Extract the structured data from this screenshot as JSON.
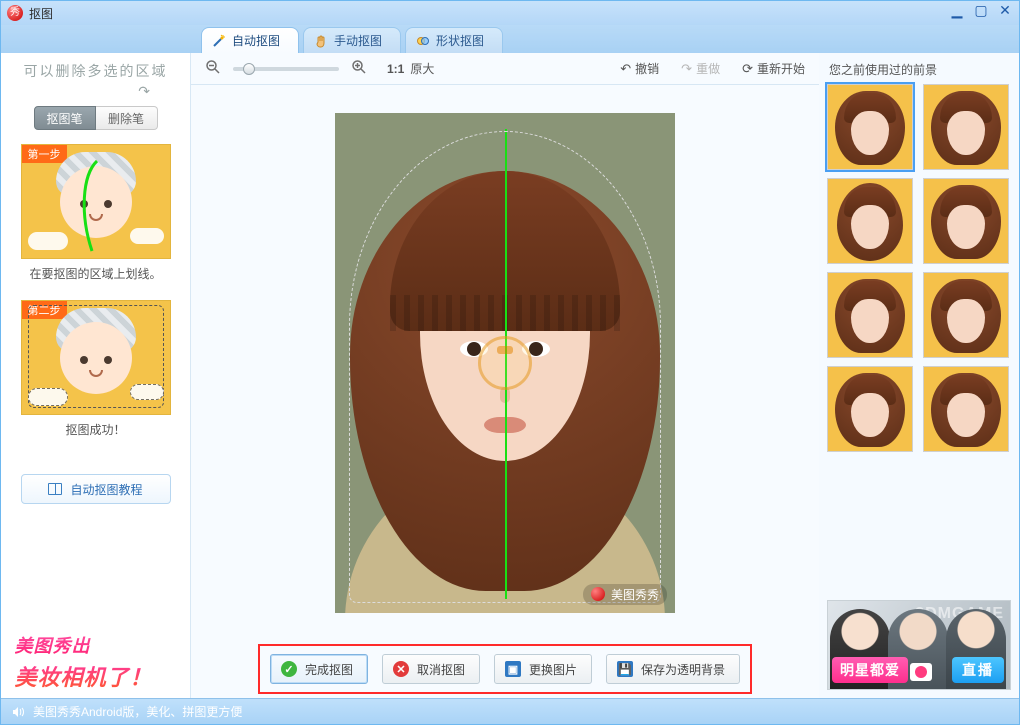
{
  "window": {
    "title": "抠图"
  },
  "tabs": [
    {
      "label": "自动抠图",
      "icon": "wand-icon"
    },
    {
      "label": "手动抠图",
      "icon": "hand-icon"
    },
    {
      "label": "形状抠图",
      "icon": "shape-icon"
    }
  ],
  "sidebar": {
    "hint": "可以删除多选的区域",
    "tools": {
      "draw": "抠图笔",
      "erase": "删除笔"
    },
    "step1": {
      "badge": "第一步",
      "caption": "在要抠图的区域上划线。"
    },
    "step2": {
      "badge": "第二步",
      "caption": "抠图成功！"
    },
    "tutorial": "自动抠图教程",
    "promo_line1": "美图秀出",
    "promo_line2": "美妆相机了！"
  },
  "toolbar": {
    "zoom_label": "1:1",
    "zoom_text": "原大",
    "undo": "撤销",
    "redo": "重做",
    "restart": "重新开始"
  },
  "canvas": {
    "watermark": "美图秀秀"
  },
  "actions": {
    "finish": "完成抠图",
    "cancel": "取消抠图",
    "replace": "更换图片",
    "save_png": "保存为透明背景"
  },
  "right": {
    "title": "您之前使用过的前景"
  },
  "ad": {
    "watermark": "3DMGAME",
    "ribbon": "明星都爱",
    "live": "直播"
  },
  "status": {
    "text": "美图秀秀Android版，美化、拼图更方便"
  }
}
